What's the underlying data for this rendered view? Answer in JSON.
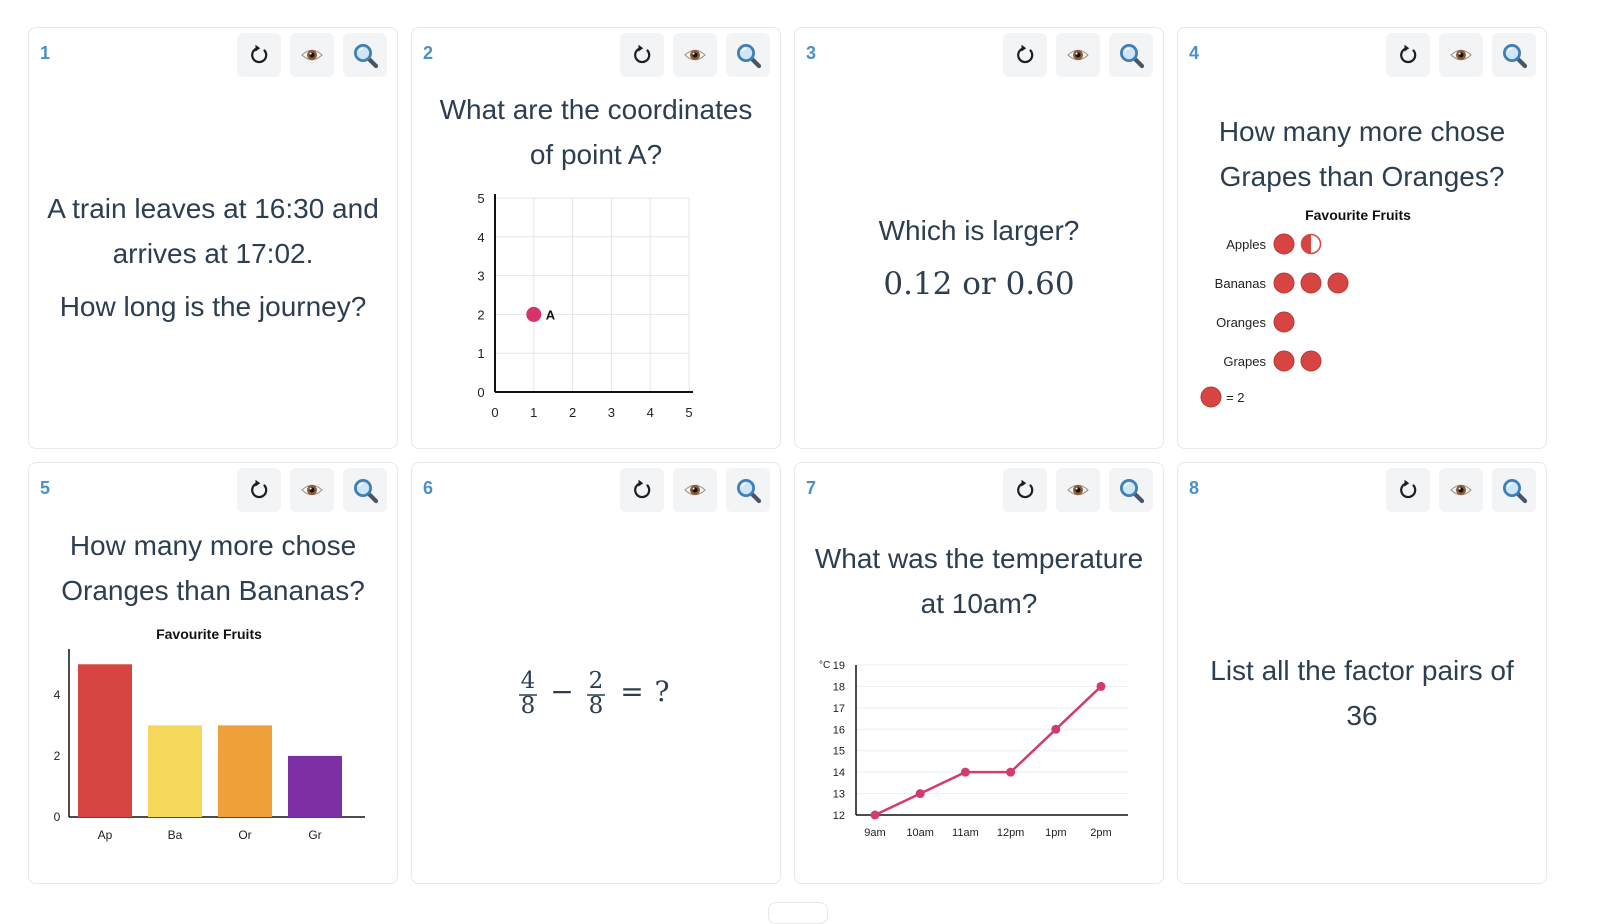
{
  "tools": {
    "refresh_icon": "refresh-icon",
    "reveal_icon": "eye-icon",
    "zoom_icon": "magnifier-icon"
  },
  "colors": {
    "accent": "#4a90c9",
    "text": "#2c3e50",
    "dot_red": "#d64541",
    "point_pink": "#d6336c"
  },
  "cards": [
    {
      "number": "1",
      "question_lines": [
        "A train leaves at 16:30 and",
        "arrives at 17:02."
      ],
      "sub_question": "How long is the journey?"
    },
    {
      "number": "2",
      "question_lines": [
        "What are the coordinates",
        "of point A?"
      ]
    },
    {
      "number": "3",
      "question_lines": [
        "Which is larger?"
      ],
      "sub_question": "0.12 or 0.60"
    },
    {
      "number": "4",
      "question_lines": [
        "How many more chose",
        "Grapes than Oranges?"
      ]
    },
    {
      "number": "5",
      "question_lines": [
        "How many more chose",
        "Oranges than Bananas?"
      ]
    },
    {
      "number": "6",
      "expression": {
        "a_num": "4",
        "a_den": "8",
        "op": "−",
        "b_num": "2",
        "b_den": "8",
        "eq": "=",
        "unknown": "?"
      }
    },
    {
      "number": "7",
      "question_lines": [
        "What was the temperature",
        "at 10am?"
      ]
    },
    {
      "number": "8",
      "question_lines": [
        "List all the factor pairs of",
        "36"
      ]
    }
  ],
  "chart_data": [
    {
      "type": "scatter",
      "title": "",
      "x_ticks": [
        "0",
        "1",
        "2",
        "3",
        "4",
        "5"
      ],
      "y_ticks": [
        "0",
        "1",
        "2",
        "3",
        "4",
        "5"
      ],
      "xlim": [
        0,
        5
      ],
      "ylim": [
        0,
        5
      ],
      "grid": true,
      "points": [
        {
          "label": "A",
          "x": 1,
          "y": 2
        }
      ]
    },
    {
      "type": "pictogram",
      "title": "Favourite Fruits",
      "categories": [
        "Apples",
        "Bananas",
        "Oranges",
        "Grapes"
      ],
      "symbol_counts": [
        1.5,
        3,
        1,
        2
      ],
      "key_label": "= 2",
      "key_value": 2
    },
    {
      "type": "bar",
      "title": "Favourite Fruits",
      "categories": [
        "Ap",
        "Ba",
        "Or",
        "Gr"
      ],
      "values": [
        5,
        3,
        3,
        2
      ],
      "y_ticks": [
        "0",
        "2",
        "4"
      ],
      "ylim": [
        0,
        5.5
      ],
      "colors": [
        "#d64541",
        "#f5d85a",
        "#f0a03a",
        "#7d2fa3"
      ]
    },
    {
      "type": "line",
      "title": "",
      "y_unit": "°C",
      "x": [
        "9am",
        "10am",
        "11am",
        "12pm",
        "1pm",
        "2pm"
      ],
      "values": [
        12,
        13,
        14,
        14,
        16,
        18
      ],
      "y_ticks": [
        "12",
        "13",
        "14",
        "15",
        "16",
        "17",
        "18",
        "19"
      ],
      "ylim": [
        12,
        19
      ],
      "grid": true
    }
  ]
}
